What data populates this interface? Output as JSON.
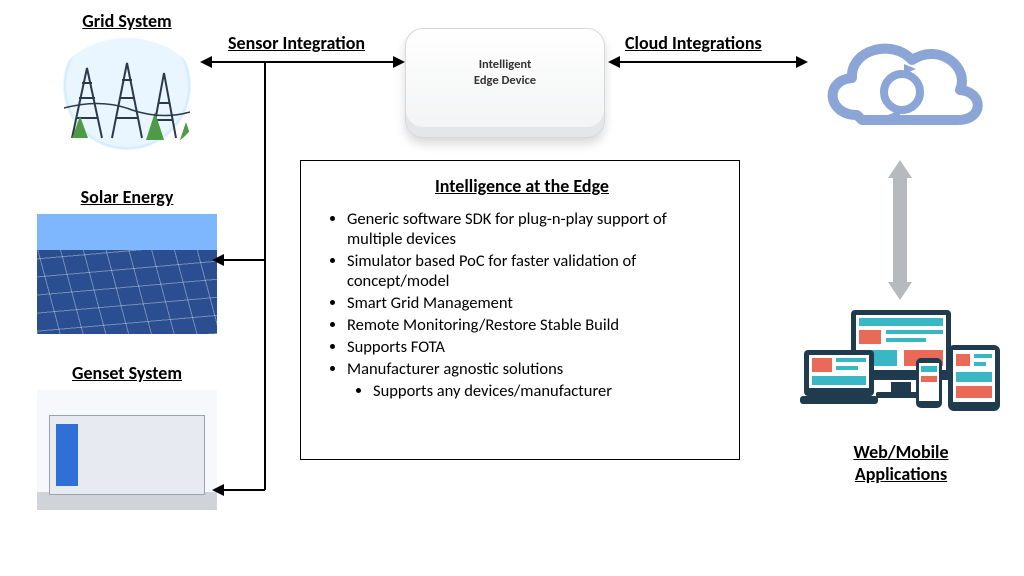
{
  "left": {
    "grid_label": "Grid System",
    "solar_label": "Solar Energy",
    "genset_label": "Genset System"
  },
  "flows": {
    "sensor_label": "Sensor Integration",
    "cloud_label": "Cloud Integrations"
  },
  "device": {
    "line1": "Intelligent",
    "line2": "Edge Device"
  },
  "box": {
    "title": "Intelligence at the Edge",
    "bullets": [
      "Generic software SDK for plug-n-play support of multiple devices",
      "Simulator based PoC for faster validation of concept/model",
      "Smart Grid Management",
      "Remote Monitoring/Restore Stable Build",
      "Supports FOTA",
      "Manufacturer agnostic solutions"
    ],
    "sub_bullet": "Supports any devices/manufacturer"
  },
  "right": {
    "apps_label_line1": "Web/Mobile",
    "apps_label_line2": "Applications"
  },
  "icons": {
    "grid": "grid-system-icon",
    "solar": "solar-panels-icon",
    "genset": "genset-icon",
    "device": "edge-device-icon",
    "cloud": "cloud-sync-icon",
    "apps": "devices-apps-icon"
  },
  "colors": {
    "cloud_stroke": "#8ba6d6",
    "app_accent": "#e96a57",
    "app_primary": "#39b7c5",
    "app_dark": "#1f3b4d"
  }
}
